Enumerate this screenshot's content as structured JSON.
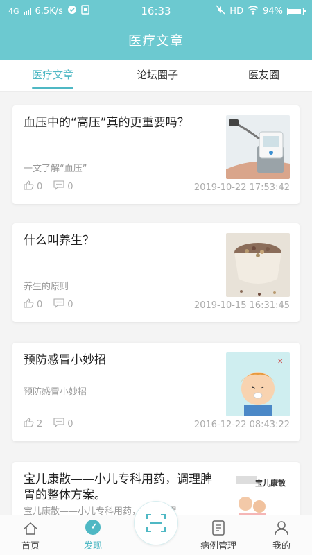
{
  "status_bar": {
    "network": "4G",
    "speed": "6.5K/s",
    "time": "16:33",
    "hd": "HD",
    "battery": "94%",
    "battery_level": 0.94
  },
  "header": {
    "title": "医疗文章"
  },
  "tabs": [
    {
      "label": "医疗文章",
      "active": true
    },
    {
      "label": "论坛圈子",
      "active": false
    },
    {
      "label": "医友圈",
      "active": false
    }
  ],
  "articles": [
    {
      "title": "血压中的“高压”真的更重要吗？",
      "summary": "一文了解“血压”",
      "likes": "0",
      "comments": "0",
      "date": "2019-10-22 17:53:42",
      "thumb": "blood-pressure-monitor-image"
    },
    {
      "title": "什么叫养生？",
      "summary": "养生的原则",
      "likes": "0",
      "comments": "0",
      "date": "2019-10-15 16:31:45",
      "thumb": "grain-bowl-image"
    },
    {
      "title": "预防感冒小妙招",
      "summary": "预防感冒小妙招",
      "likes": "2",
      "comments": "0",
      "date": "2016-12-22 08:43:22",
      "thumb": "sneezing-child-cartoon-image"
    },
    {
      "title": "宝儿康散——小儿专科用药，调理脾胃的整体方案。",
      "summary": "宝儿康散——小儿专科用药，调理脾胃",
      "thumb": "baoerkang-product-image",
      "thumb_text": "宝儿康散"
    }
  ],
  "bottom_nav": [
    {
      "label": "首页",
      "icon": "home-icon",
      "active": false
    },
    {
      "label": "发现",
      "icon": "discover-icon",
      "active": true
    },
    {
      "label": "",
      "icon": "scan-icon",
      "active": false
    },
    {
      "label": "病例管理",
      "icon": "document-icon",
      "active": false
    },
    {
      "label": "我的",
      "icon": "user-icon",
      "active": false
    }
  ],
  "colors": {
    "primary": "#6cc9d0",
    "accent": "#4fb8c4"
  }
}
